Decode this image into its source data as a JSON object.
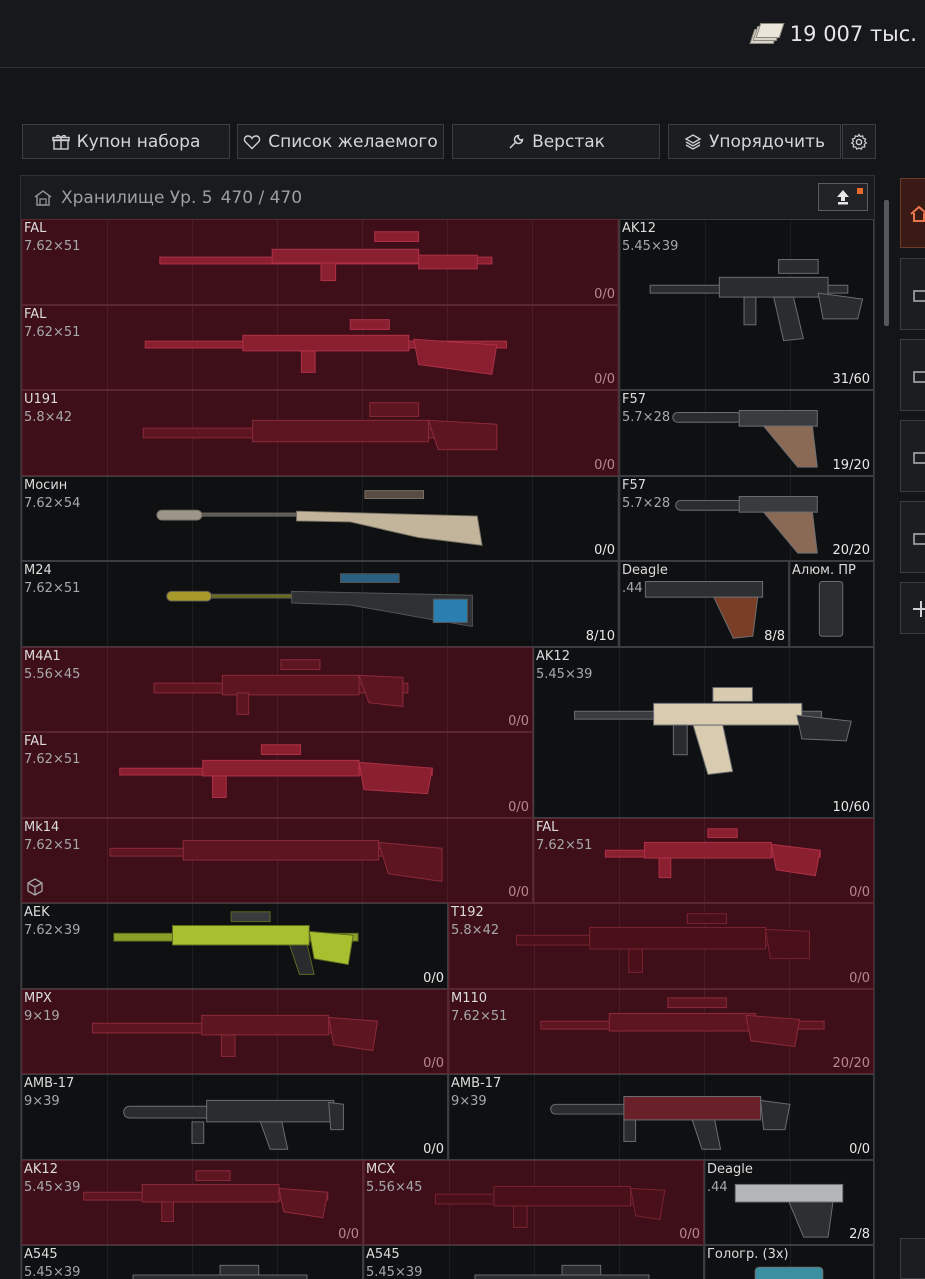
{
  "header": {
    "money": "19 007 тыс.",
    "money_icon": "banknotes-icon"
  },
  "toolbar": {
    "coupon": "Купон набора",
    "wishlist": "Список желаемого",
    "workbench": "Верстак",
    "sort": "Упорядочить"
  },
  "stash": {
    "title": "Хранилище Ур. 5",
    "capacity": "470 / 470"
  },
  "colors": {
    "red_cell": "#3e0f18",
    "dark_cell": "#0f1012",
    "accent": "#e86a2a"
  },
  "items": [
    {
      "name": "FAL",
      "caliber": "7.62×51",
      "count": "0/0"
    },
    {
      "name": "AK12",
      "caliber": "5.45×39",
      "count": ""
    },
    {
      "name": "FAL",
      "caliber": "7.62×51",
      "count": "0/0"
    },
    {
      "name": "",
      "caliber": "",
      "count": "31/60"
    },
    {
      "name": "U191",
      "caliber": "5.8×42",
      "count": "0/0"
    },
    {
      "name": "F57",
      "caliber": "5.7×28",
      "count": "19/20"
    },
    {
      "name": "Мосин",
      "caliber": "7.62×54",
      "count": "0/0"
    },
    {
      "name": "F57",
      "caliber": "5.7×28",
      "count": "20/20"
    },
    {
      "name": "M24",
      "caliber": "7.62×51",
      "count": "8/10"
    },
    {
      "name": "Deagle",
      "caliber": ".44",
      "count": "8/8"
    },
    {
      "name": "Алюм. ПР",
      "caliber": "",
      "count": ""
    },
    {
      "name": "M4A1",
      "caliber": "5.56×45",
      "count": "0/0"
    },
    {
      "name": "AK12",
      "caliber": "5.45×39",
      "count": "10/60"
    },
    {
      "name": "FAL",
      "caliber": "7.62×51",
      "count": "0/0"
    },
    {
      "name": "Mk14",
      "caliber": "7.62×51",
      "count": "0/0"
    },
    {
      "name": "FAL",
      "caliber": "7.62×51",
      "count": "0/0"
    },
    {
      "name": "AEK",
      "caliber": "7.62×39",
      "count": "0/0"
    },
    {
      "name": "T192",
      "caliber": "5.8×42",
      "count": "0/0"
    },
    {
      "name": "MPX",
      "caliber": "9×19",
      "count": "0/0"
    },
    {
      "name": "M110",
      "caliber": "7.62×51",
      "count": "20/20"
    },
    {
      "name": "AMB-17",
      "caliber": "9×39",
      "count": "0/0"
    },
    {
      "name": "AMB-17",
      "caliber": "9×39",
      "count": "0/0"
    },
    {
      "name": "AK12",
      "caliber": "5.45×39",
      "count": "0/0"
    },
    {
      "name": "MCX",
      "caliber": "5.56×45",
      "count": "0/0"
    },
    {
      "name": "Deagle",
      "caliber": ".44",
      "count": "2/8"
    },
    {
      "name": "A545",
      "caliber": "5.45×39",
      "count": ""
    },
    {
      "name": "A545",
      "caliber": "5.45×39",
      "count": ""
    },
    {
      "name": "Гологр. (3x)",
      "caliber": "",
      "count": ""
    }
  ]
}
